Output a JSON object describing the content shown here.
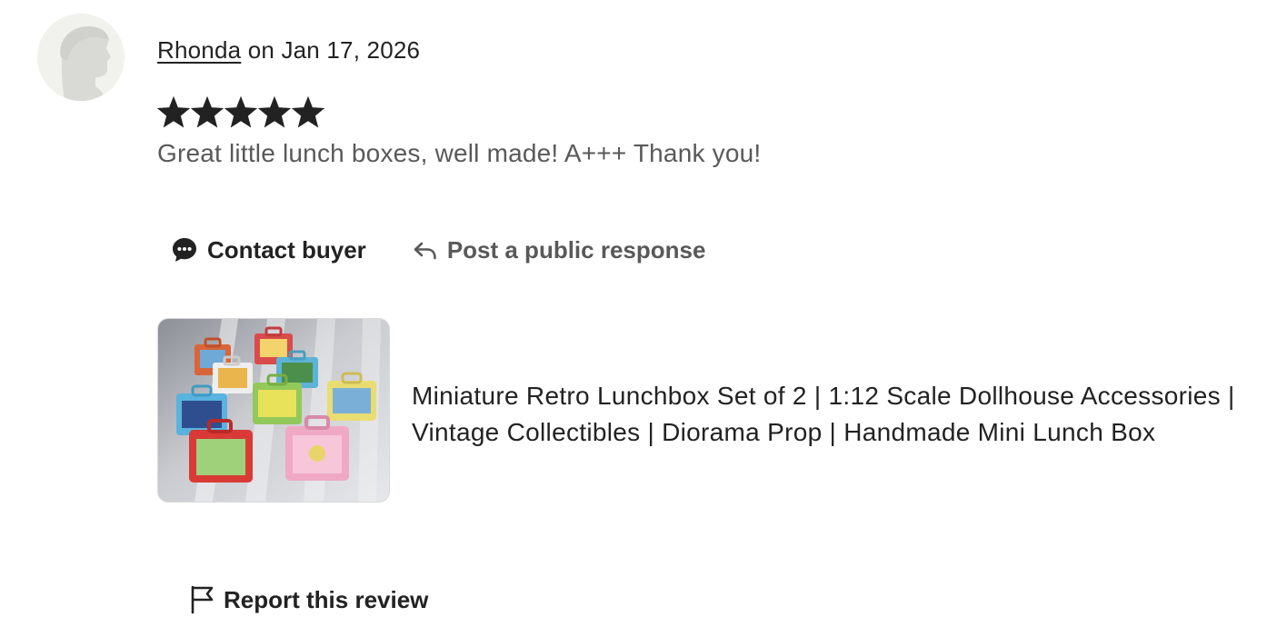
{
  "review": {
    "reviewer_name": "Rhonda",
    "date_text": " on Jan 17, 2026",
    "rating": 5,
    "rating_max": 5,
    "text": "Great little lunch boxes, well made! A+++ Thank you!"
  },
  "actions": {
    "contact_label": "Contact buyer",
    "respond_label": "Post a public response"
  },
  "listing": {
    "title": "Miniature Retro Lunchbox Set of 2 | 1:12 Scale Dollhouse Accessories | Vintage Collectibles | Diorama Prop | Handmade Mini Lunch Box"
  },
  "report": {
    "label": "Report this review"
  },
  "icons": {
    "avatar": "person-silhouette-icon",
    "star": "star-icon",
    "contact": "chat-bubble-icon",
    "respond": "reply-arrow-icon",
    "report": "flag-icon"
  },
  "colors": {
    "text_primary": "#222222",
    "text_secondary": "#595959",
    "avatar_bg": "#f1f1ee",
    "star": "#222222"
  }
}
